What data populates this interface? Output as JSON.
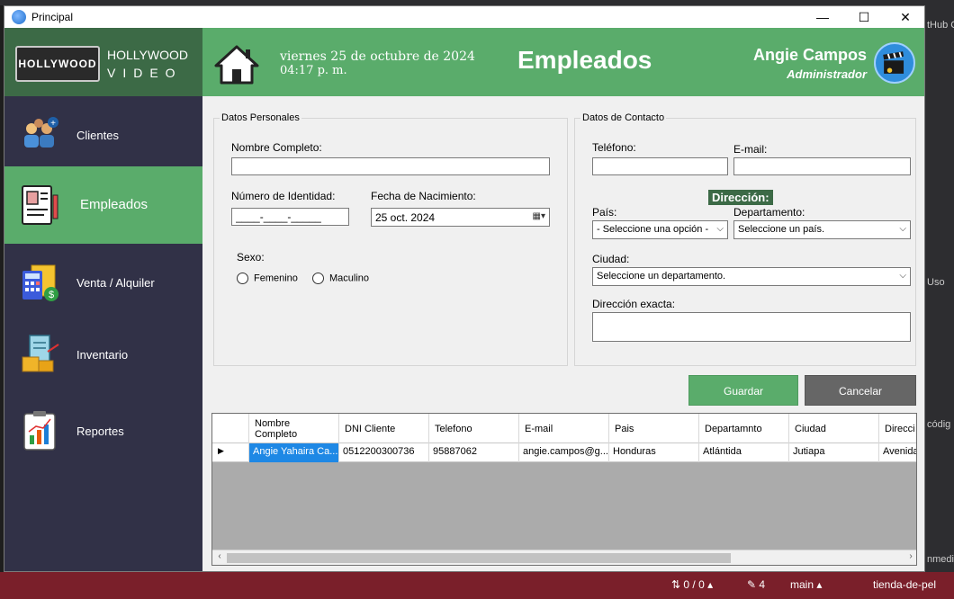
{
  "window": {
    "title": "Principal",
    "minimize": "—",
    "maximize": "☐",
    "close": "✕"
  },
  "ide": {
    "right_fragments": [
      "tHub C",
      "Uso",
      "códig",
      "nmedi"
    ],
    "status": {
      "sync": "⇅ 0 / 0 ▴",
      "edits": "✎ 4",
      "branch": "main ▴",
      "repo": "tienda-de-pel"
    }
  },
  "logo": {
    "badge": "HOLLYWOOD",
    "title": "HOLLYWOOD",
    "subtitle": "VIDEO"
  },
  "nav": [
    {
      "label": "Clientes",
      "icon": "clients-icon"
    },
    {
      "label": "Empleados",
      "icon": "employee-id-icon"
    },
    {
      "label": "Venta / Alquiler",
      "icon": "calculator-icon"
    },
    {
      "label": "Inventario",
      "icon": "inventory-icon"
    },
    {
      "label": "Reportes",
      "icon": "report-chart-icon"
    }
  ],
  "header": {
    "date": "viernes 25 de octubre de 2024",
    "time": "04:17 p. m.",
    "title": "Empleados",
    "user_name": "Angie Campos",
    "user_role": "Administrador"
  },
  "personal": {
    "legend": "Datos Personales",
    "full_name_label": "Nombre Completo:",
    "full_name_value": "",
    "id_label": "Número de Identidad:",
    "id_value": "____-____-_____",
    "birth_label": "Fecha de Nacimiento:",
    "birth_value": "25 oct.  2024",
    "sex_label": "Sexo:",
    "sex_options": [
      "Femenino",
      "Maculino"
    ]
  },
  "contact": {
    "legend": "Datos de Contacto",
    "phone_label": "Teléfono:",
    "email_label": "E-mail:",
    "address_header": "Dirección:",
    "country_label": "País:",
    "country_value": "- Seleccione una opción -",
    "dept_label": "Departamento:",
    "dept_value": "Seleccione un país.",
    "city_label": "Ciudad:",
    "city_value": "Seleccione un departamento.",
    "exact_label": "Dirección exacta:"
  },
  "actions": {
    "save": "Guardar",
    "cancel": "Cancelar"
  },
  "grid": {
    "columns": [
      "Nombre Completo",
      "DNI Cliente",
      "Telefono",
      "E-mail",
      "Pais",
      "Departamnto",
      "Ciudad",
      "Direcci"
    ],
    "rows": [
      [
        "Angie Yahaira Ca...",
        "0512200300736",
        "95887062",
        "angie.campos@g...",
        "Honduras",
        "Atlántida",
        "Jutiapa",
        "Avenida"
      ]
    ],
    "row_marker": "▶"
  }
}
